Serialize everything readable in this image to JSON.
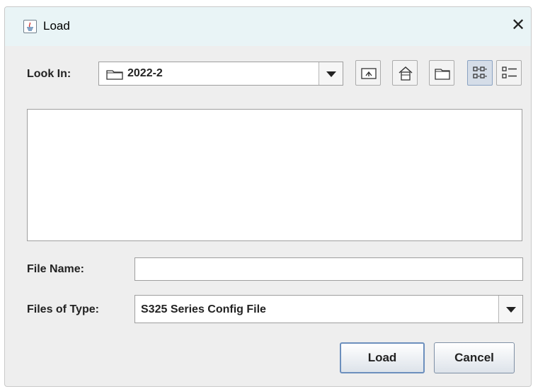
{
  "window": {
    "title": "Load"
  },
  "look_in": {
    "label": "Look In:",
    "value": "2022-2"
  },
  "toolbar": {
    "buttons": [
      "up-one-level",
      "home",
      "new-folder",
      "list-view",
      "details-view"
    ],
    "selected": "list-view"
  },
  "file_name": {
    "label": "File Name:",
    "value": ""
  },
  "files_of_type": {
    "label": "Files of Type:",
    "value": "S325 Series Config File"
  },
  "actions": {
    "load": "Load",
    "cancel": "Cancel"
  }
}
